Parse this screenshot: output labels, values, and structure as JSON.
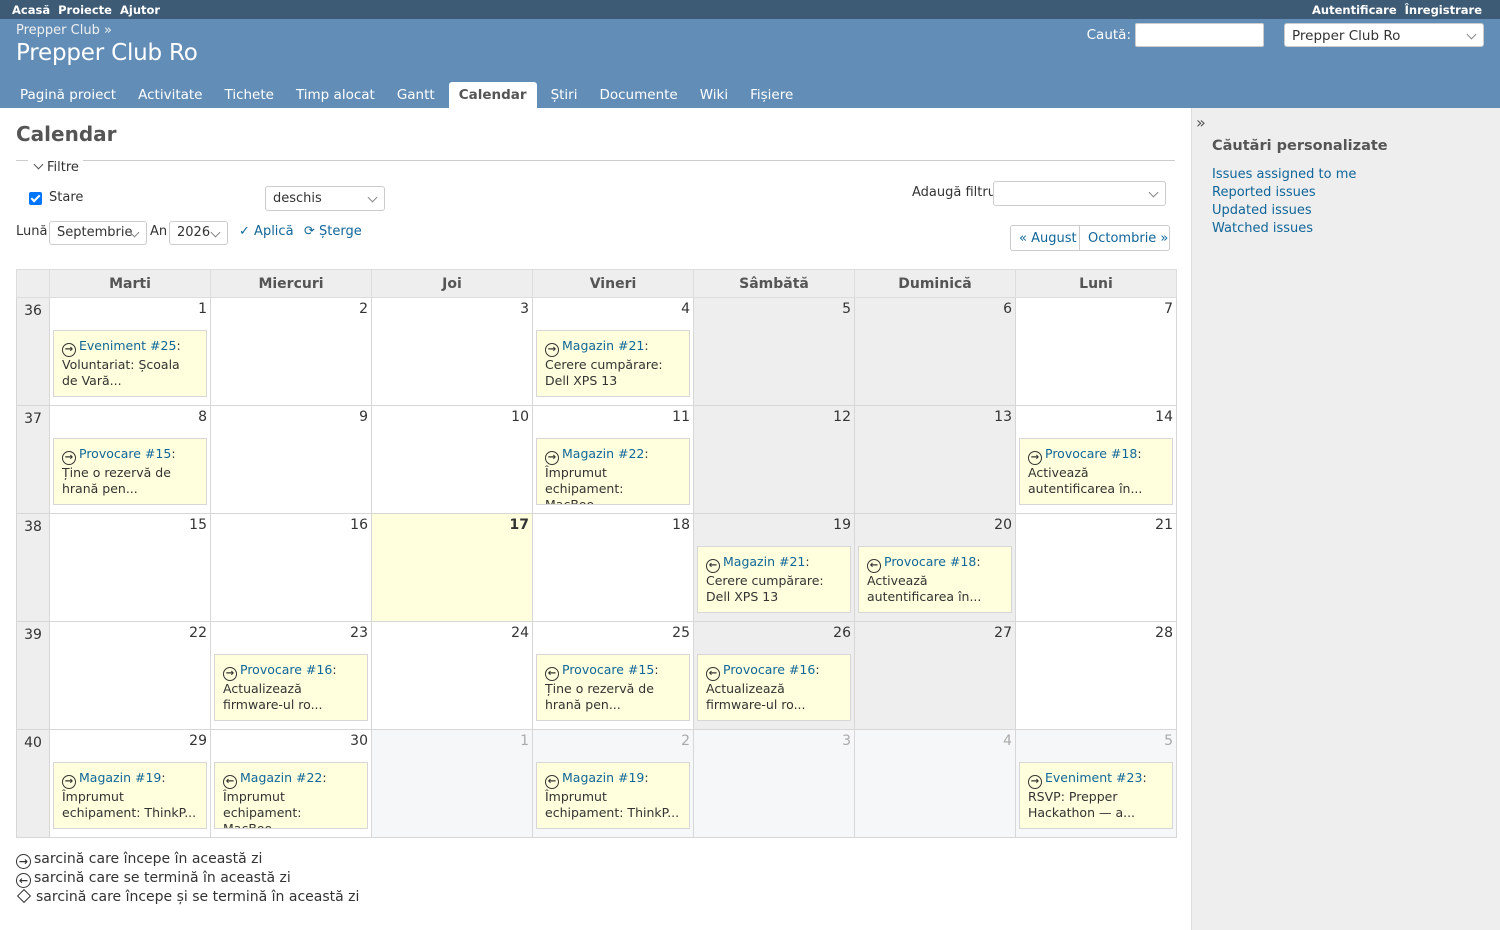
{
  "top_menu": {
    "left": [
      "Acasă",
      "Proiecte",
      "Ajutor"
    ],
    "right": [
      "Autentificare",
      "Înregistrare"
    ]
  },
  "header": {
    "breadcrumb": "Prepper Club »",
    "title": "Prepper Club Ro",
    "search_label": "Caută:",
    "project_select": "Prepper Club Ro"
  },
  "tabs": [
    "Pagină proiect",
    "Activitate",
    "Tichete",
    "Timp alocat",
    "Gantt",
    "Calendar",
    "Știri",
    "Documente",
    "Wiki",
    "Fișiere"
  ],
  "selected_tab": "Calendar",
  "page_title": "Calendar",
  "filters": {
    "legend": "Filtre",
    "status_label": "Stare",
    "status_value": "deschis",
    "add_filter_label": "Adaugă filtru",
    "month_label": "Lună",
    "month_value": "Septembrie",
    "year_label": "An",
    "year_value": "2026",
    "apply": "Aplică",
    "clear": "Șterge"
  },
  "nav": {
    "prev": "« August",
    "next": "Octombrie »"
  },
  "weekdays": [
    "Marti",
    "Miercuri",
    "Joi",
    "Vineri",
    "Sâmbătă",
    "Duminică",
    "Luni"
  ],
  "weeks": [
    {
      "num": "36",
      "days": [
        "1",
        "2",
        "3",
        "4",
        "5",
        "6",
        "7"
      ]
    },
    {
      "num": "37",
      "days": [
        "8",
        "9",
        "10",
        "11",
        "12",
        "13",
        "14"
      ]
    },
    {
      "num": "38",
      "days": [
        "15",
        "16",
        "17",
        "18",
        "19",
        "20",
        "21"
      ]
    },
    {
      "num": "39",
      "days": [
        "22",
        "23",
        "24",
        "25",
        "26",
        "27",
        "28"
      ]
    },
    {
      "num": "40",
      "days": [
        "29",
        "30",
        "1",
        "2",
        "3",
        "4",
        "5"
      ]
    }
  ],
  "issues": [
    {
      "week": 0,
      "day": 0,
      "icon": "start",
      "title": "Eveniment #25",
      "text": "Voluntariat: Școala de Vară..."
    },
    {
      "week": 0,
      "day": 3,
      "icon": "start",
      "title": "Magazin #21",
      "text": "Cerere cumpărare: Dell XPS 13"
    },
    {
      "week": 1,
      "day": 0,
      "icon": "start",
      "title": "Provocare #15",
      "text": "Ține o rezervă de hrană pen..."
    },
    {
      "week": 1,
      "day": 3,
      "icon": "start",
      "title": "Magazin #22",
      "text": "Împrumut echipament: MacBoo..."
    },
    {
      "week": 1,
      "day": 6,
      "icon": "start",
      "title": "Provocare #18",
      "text": "Activează autentificarea în..."
    },
    {
      "week": 2,
      "day": 4,
      "icon": "end",
      "title": "Magazin #21",
      "text": "Cerere cumpărare: Dell XPS 13"
    },
    {
      "week": 2,
      "day": 5,
      "icon": "end",
      "title": "Provocare #18",
      "text": "Activează autentificarea în..."
    },
    {
      "week": 3,
      "day": 1,
      "icon": "start",
      "title": "Provocare #16",
      "text": "Actualizează firmware-ul ro..."
    },
    {
      "week": 3,
      "day": 3,
      "icon": "end",
      "title": "Provocare #15",
      "text": "Ține o rezervă de hrană pen..."
    },
    {
      "week": 3,
      "day": 4,
      "icon": "end",
      "title": "Provocare #16",
      "text": "Actualizează firmware-ul ro..."
    },
    {
      "week": 4,
      "day": 0,
      "icon": "start",
      "title": "Magazin #19",
      "text": "Împrumut echipament: ThinkP..."
    },
    {
      "week": 4,
      "day": 1,
      "icon": "end",
      "title": "Magazin #22",
      "text": "Împrumut echipament: MacBoo..."
    },
    {
      "week": 4,
      "day": 3,
      "icon": "end",
      "title": "Magazin #19",
      "text": "Împrumut echipament: ThinkP..."
    },
    {
      "week": 4,
      "day": 6,
      "icon": "start",
      "title": "Eveniment #23",
      "text": "RSVP: Prepper Hackathon — a..."
    }
  ],
  "legend": {
    "start": "sarcină care începe în această zi",
    "end": "sarcină care se termină în această zi",
    "both": "sarcină care începe și se termină în această zi"
  },
  "sidebar": {
    "title": "Căutări personalizate",
    "links": [
      "Issues assigned to me",
      "Reported issues",
      "Updated issues",
      "Watched issues"
    ]
  }
}
